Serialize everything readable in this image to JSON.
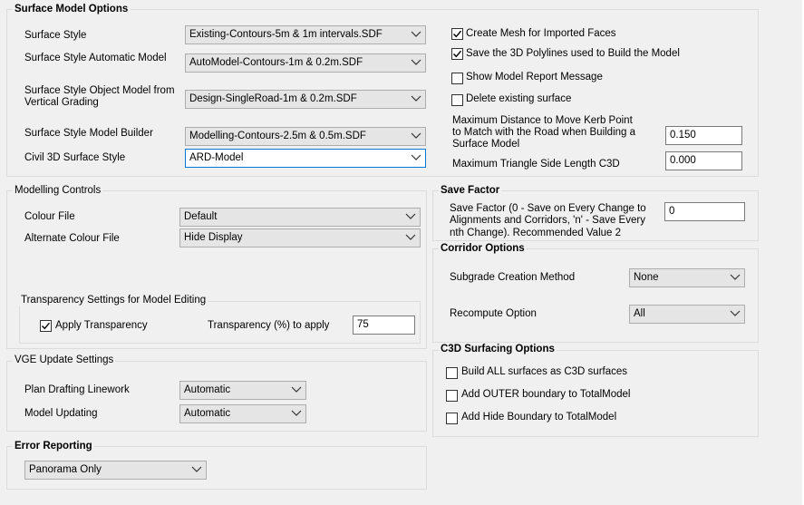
{
  "surface_model_options": {
    "title": "Surface Model Options",
    "surface_style": {
      "label": "Surface Style",
      "value": "Existing-Contours-5m & 1m intervals.SDF"
    },
    "auto_model": {
      "label": "Surface Style Automatic Model",
      "value": "AutoModel-Contours-1m & 0.2m.SDF"
    },
    "object_model": {
      "label_line1": "Surface Style Object Model from",
      "label_line2": "Vertical Grading",
      "value": "Design-SingleRoad-1m & 0.2m.SDF"
    },
    "model_builder": {
      "label": "Surface Style Model Builder",
      "value": "Modelling-Contours-2.5m & 0.5m.SDF"
    },
    "civil3d_style": {
      "label": "Civil 3D Surface Style",
      "value": "ARD-Model"
    },
    "checks": [
      {
        "label": "Create Mesh for Imported Faces",
        "checked": true
      },
      {
        "label": "Save the 3D Polylines used to Build the Model",
        "checked": true
      },
      {
        "label": "Show Model Report Message",
        "checked": false
      },
      {
        "label": "Delete existing surface",
        "checked": false
      }
    ],
    "max_distance": {
      "label_line1": "Maximum Distance to Move Kerb Point",
      "label_line2": "to Match with the Road when Building a",
      "label_line3": "Surface Model",
      "value": "0.150"
    },
    "max_triangle": {
      "label": "Maximum Triangle Side Length C3D",
      "value": "0.000"
    }
  },
  "modelling_controls": {
    "title": "Modelling Controls",
    "colour_file": {
      "label": "Colour File",
      "value": "Default"
    },
    "alt_colour_file": {
      "label": "Alternate Colour File",
      "value": "Hide Display"
    },
    "transparency": {
      "title": "Transparency Settings for Model Editing",
      "apply_label": "Apply Transparency",
      "apply_checked": true,
      "percent_label": "Transparency (%) to apply",
      "percent_value": "75"
    }
  },
  "vge_update": {
    "title": "VGE Update Settings",
    "plan_drafting": {
      "label": "Plan Drafting Linework",
      "value": "Automatic"
    },
    "model_updating": {
      "label": "Model Updating",
      "value": "Automatic"
    }
  },
  "error_reporting": {
    "title": "Error Reporting",
    "value": "Panorama Only"
  },
  "save_factor": {
    "title": "Save Factor",
    "label_line1": "Save Factor (0 - Save on Every Change to",
    "label_line2": "Alignments and Corridors, 'n' - Save Every",
    "label_line3": "nth Change). Recommended Value 2",
    "value": "0"
  },
  "corridor_options": {
    "title": "Corridor Options",
    "subgrade": {
      "label": "Subgrade Creation Method",
      "value": "None"
    },
    "recompute": {
      "label": "Recompute Option",
      "value": "All"
    }
  },
  "c3d_surfacing": {
    "title": "C3D Surfacing Options",
    "checks": [
      {
        "label": "Build ALL surfaces as C3D surfaces",
        "checked": false
      },
      {
        "label": "Add OUTER boundary to TotalModel",
        "checked": false
      },
      {
        "label": "Add Hide Boundary to TotalModel",
        "checked": false
      }
    ]
  },
  "colors": {
    "window_bg": "#f0f0f0",
    "focus_border": "#0078d7",
    "group_border": "#dcdcdc"
  }
}
